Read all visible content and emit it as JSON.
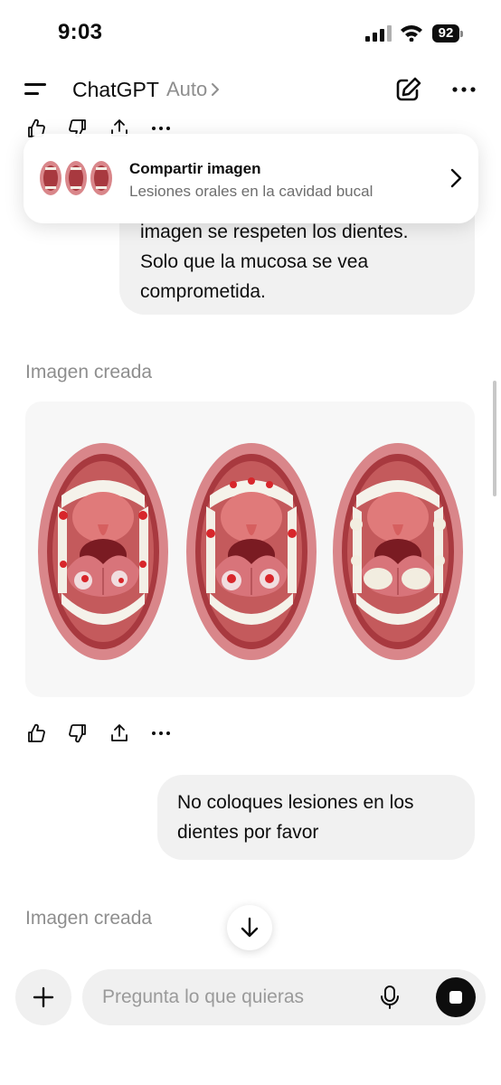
{
  "status_bar": {
    "time": "9:03",
    "battery": "92"
  },
  "header": {
    "title": "ChatGPT",
    "model": "Auto"
  },
  "share": {
    "title": "Compartir imagen",
    "subtitle": "Lesiones orales en la cavidad bucal"
  },
  "messages": {
    "user_1": {
      "lines": [
        "imagen se respeten los dientes.",
        "Solo que la mucosa se vea",
        "comprometida."
      ]
    },
    "assistant_1": {
      "label": "Imagen creada"
    },
    "user_2": {
      "lines": [
        "No coloques lesiones en los",
        "dientes por favor"
      ]
    },
    "assistant_2": {
      "label": "Imagen creada"
    }
  },
  "composer": {
    "placeholder": "Pregunta lo que quieras"
  },
  "icons": {
    "menu": "menu-icon",
    "new_chat": "compose-icon",
    "more": "more-icon",
    "like": "thumbs-up-icon",
    "dislike": "thumbs-down-icon",
    "share": "share-icon",
    "chevron": "chevron-right-icon",
    "arrow_down": "arrow-down-icon",
    "plus": "plus-icon",
    "mic": "microphone-icon",
    "stop": "stop-icon"
  },
  "colors": {
    "accent": "#0d0d0d",
    "bubble": "#f1f1f1",
    "muted": "#8e8e8e"
  }
}
